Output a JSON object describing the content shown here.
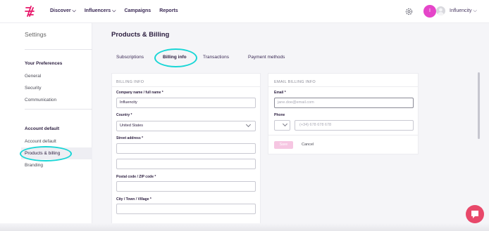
{
  "header": {
    "nav": [
      "Discover",
      "Influencers",
      "Campaigns",
      "Reports"
    ],
    "avatar_initial": "I",
    "account_name": "Influencity",
    "brand_color": "#e8176a",
    "avatar_color": "#e545c9"
  },
  "sidebar": {
    "title": "Settings",
    "preferences_heading": "Your Preferences",
    "preferences_items": [
      "General",
      "Security",
      "Communication"
    ],
    "account_heading": "Account default",
    "account_items": [
      "Account default",
      "Products & billing",
      "Branding"
    ],
    "active_item": "Products & billing"
  },
  "main": {
    "title": "Products & Billing",
    "tabs": [
      "Subscriptions",
      "Billing info",
      "Transactions",
      "Payment methods"
    ],
    "active_tab": "Billing info",
    "billing_info": {
      "heading": "BILLING INFO",
      "company_label": "Company name / full name *",
      "company_value": "Influencity",
      "country_label": "Country *",
      "country_value": "United States",
      "street_label": "Street address *",
      "postal_label": "Postal code / ZIP code *",
      "city_label": "City / Town / Village *"
    },
    "email_billing": {
      "heading": "EMAIL BILLING INFO",
      "email_label": "Email *",
      "email_placeholder": "jane.doe@email.com",
      "phone_label": "Phone",
      "phone_placeholder": "(+34) 678 678 678",
      "save_label": "Save",
      "cancel_label": "Cancel"
    }
  },
  "annotation_color": "#19d6d6"
}
